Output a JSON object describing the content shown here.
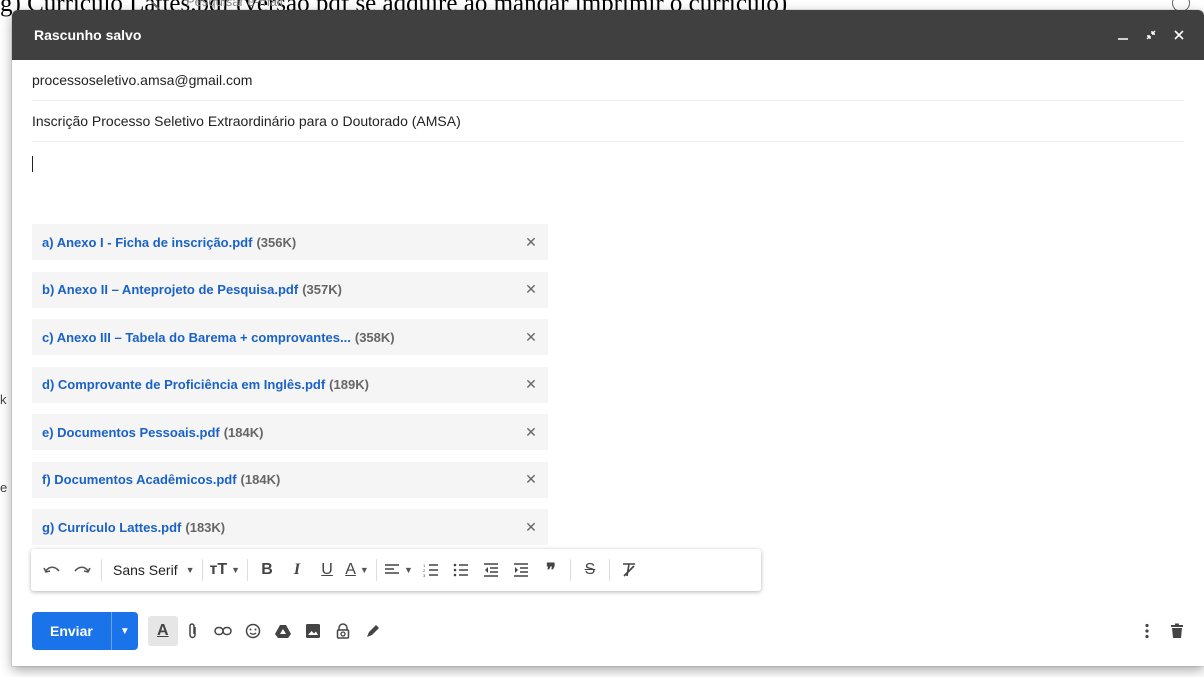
{
  "background": {
    "heading": "g) Currículo Lattes.pdf (versão pdf se adquire ao mandar imprimir o currículo)",
    "search_placeholder": "Pesquisar e-mail",
    "left_fragments": [
      "k",
      "e"
    ]
  },
  "compose": {
    "title": "Rascunho salvo",
    "recipient": "processoseletivo.amsa@gmail.com",
    "subject": "Inscrição Processo Seletivo Extraordinário para o Doutorado (AMSA)",
    "attachments": [
      {
        "name": "a) Anexo I - Ficha de inscrição.pdf",
        "size": "(356K)"
      },
      {
        "name": "b) Anexo II – Anteprojeto de Pesquisa.pdf",
        "size": "(357K)"
      },
      {
        "name": "c) Anexo III – Tabela do Barema + comprovantes...",
        "size": "(358K)"
      },
      {
        "name": "d) Comprovante de Proficiência em Inglês.pdf",
        "size": "(189K)"
      },
      {
        "name": "e) Documentos Pessoais.pdf",
        "size": "(184K)"
      },
      {
        "name": "f) Documentos Acadêmicos.pdf",
        "size": "(184K)"
      },
      {
        "name": "g) Currículo Lattes.pdf",
        "size": "(183K)"
      }
    ],
    "format_bar": {
      "font": "Sans Serif"
    },
    "send_label": "Enviar"
  }
}
